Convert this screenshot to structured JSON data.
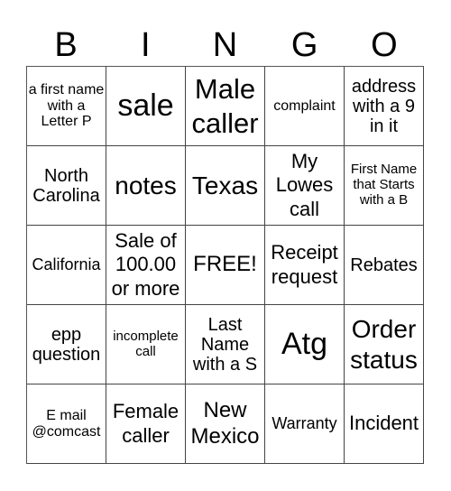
{
  "header": {
    "letters": [
      "B",
      "I",
      "N",
      "G",
      "O"
    ]
  },
  "cells": [
    [
      "a first name with a Letter P",
      "sale",
      "Male caller",
      "complaint",
      "address with a 9 in it"
    ],
    [
      "North Carolina",
      "notes",
      "Texas",
      "My Lowes call",
      "First Name that Starts with a B"
    ],
    [
      "California",
      "Sale of 100.00 or more",
      "FREE!",
      "Receipt request",
      "Rebates"
    ],
    [
      "epp question",
      "incomplete call",
      "Last Name with a S",
      "Atg",
      "Order status"
    ],
    [
      "E mail @comcast",
      "Female caller",
      "New Mexico",
      "Warranty",
      "Incident"
    ]
  ]
}
